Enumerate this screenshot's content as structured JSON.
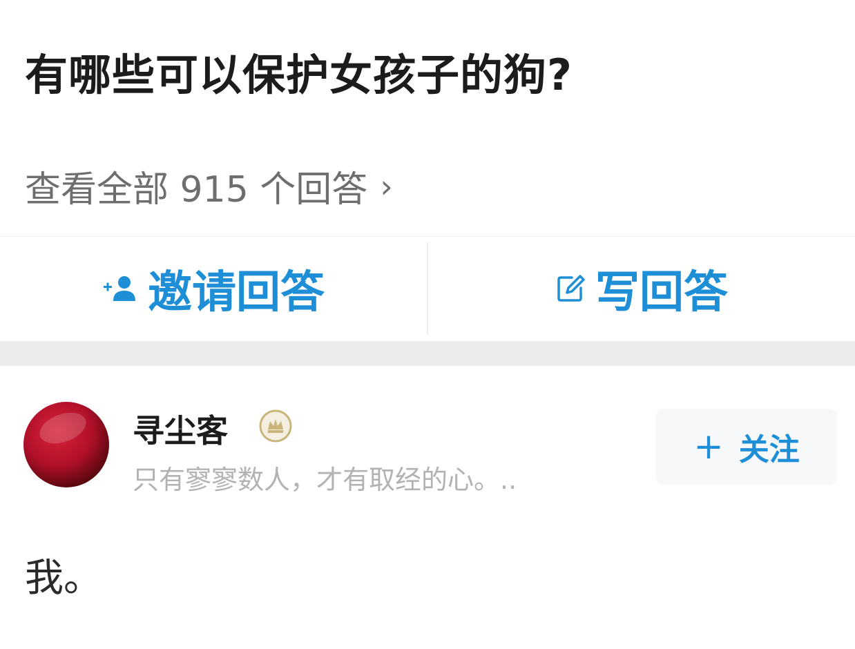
{
  "question": {
    "title": "有哪些可以保护女孩子的狗?"
  },
  "answers_link": {
    "label": "查看全部 915 个回答",
    "chevron": "›"
  },
  "actions": {
    "invite_label": "邀请回答",
    "invite_icon": "add-user-icon",
    "write_label": "写回答",
    "write_icon": "edit-icon",
    "accent_color": "#1e8fd6"
  },
  "answer": {
    "author_name": "寻尘客",
    "author_bio": "只有寥寥数人，才有取经的心。..",
    "follow_plus": "+",
    "follow_label": "关注",
    "content": "我。"
  }
}
